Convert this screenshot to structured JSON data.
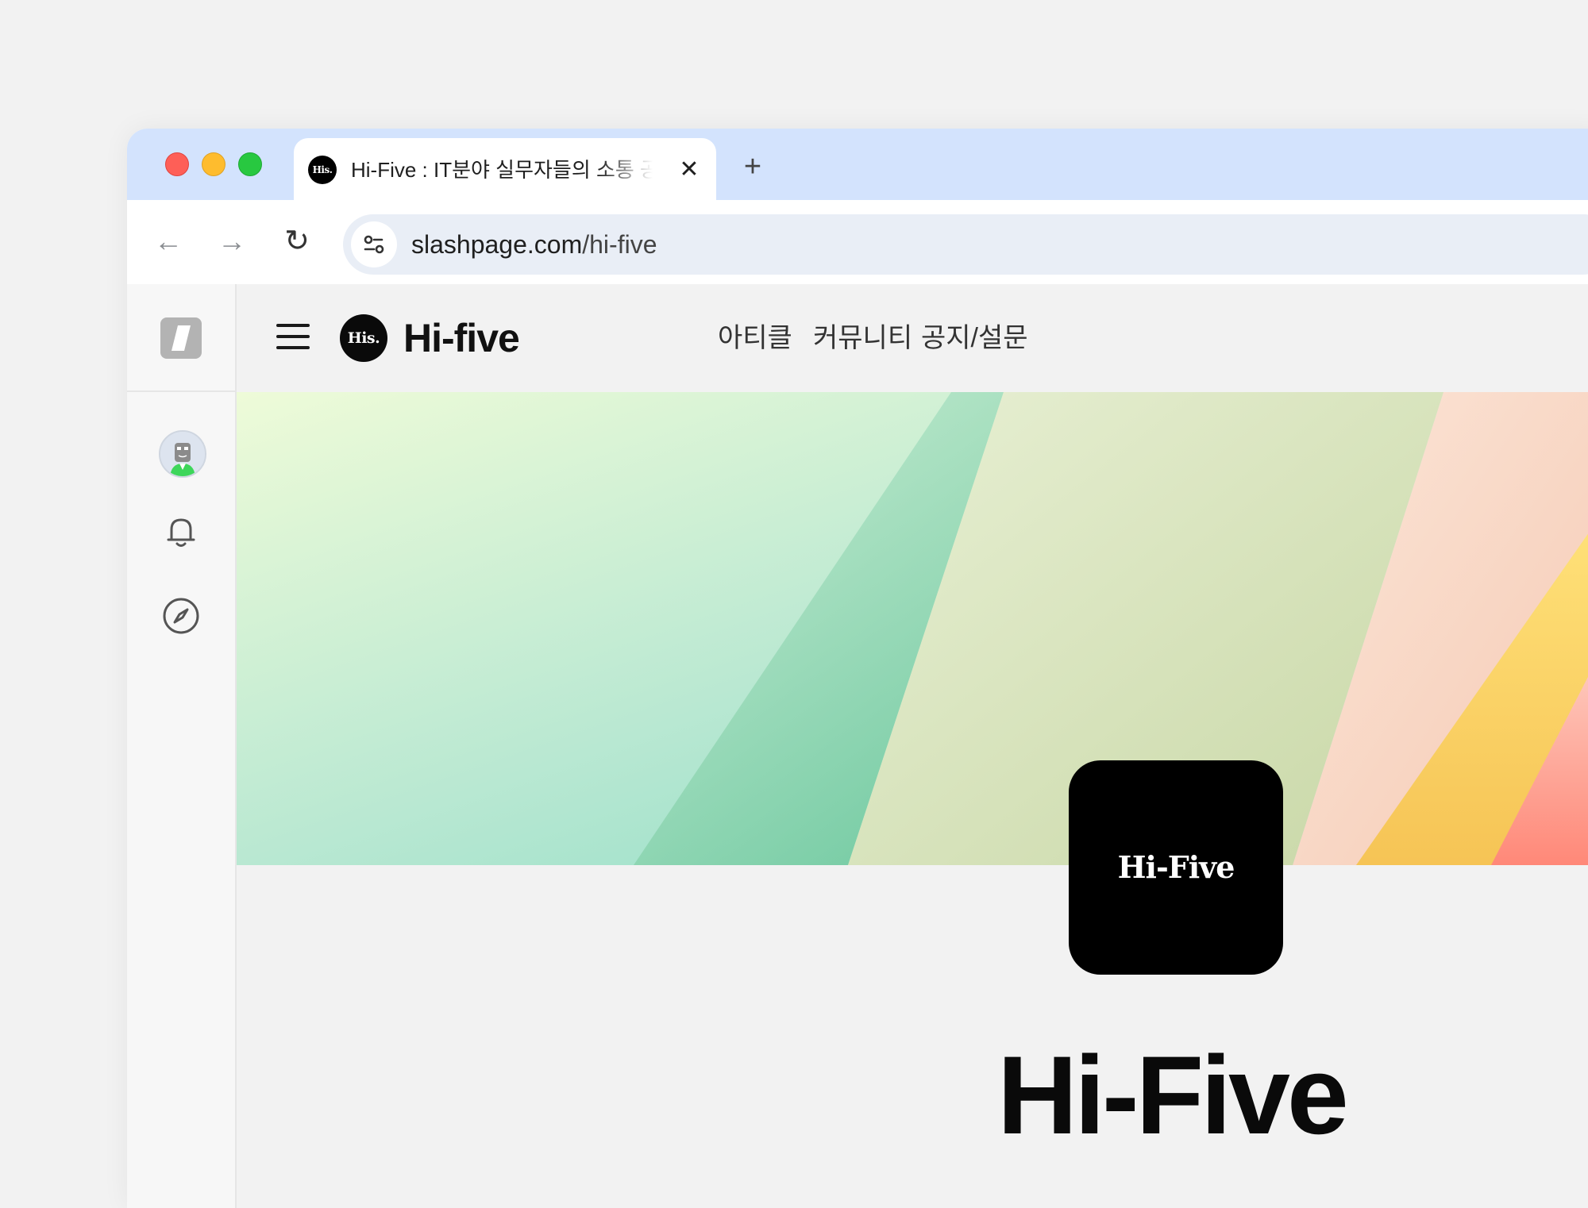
{
  "browser": {
    "tab": {
      "favicon_text": "His.",
      "title": "Hi-Five : IT분야 실무자들의 소통 공간"
    },
    "address_bar": {
      "domain": "slashpage.com",
      "path": "/hi-five"
    },
    "icons": {
      "close": "close-icon",
      "new_tab": "plus-icon",
      "back": "back-arrow-icon",
      "forward": "forward-arrow-icon",
      "reload": "reload-icon",
      "site_info": "tune-icon"
    },
    "traffic_lights": {
      "red": "#fe5f57",
      "yellow": "#febc2e",
      "green": "#28c840"
    },
    "tabstrip_color": "#d3e3fd"
  },
  "rail": {
    "icons": [
      "slashpage-logo-icon",
      "avatar",
      "bell-icon",
      "compass-icon"
    ]
  },
  "header": {
    "logo_text": "His.",
    "brand_name": "Hi-five",
    "nav": [
      "아티클",
      "커뮤니티",
      "공지/설문"
    ]
  },
  "profile": {
    "tile_text": "Hi-Five",
    "title": "Hi-Five"
  }
}
